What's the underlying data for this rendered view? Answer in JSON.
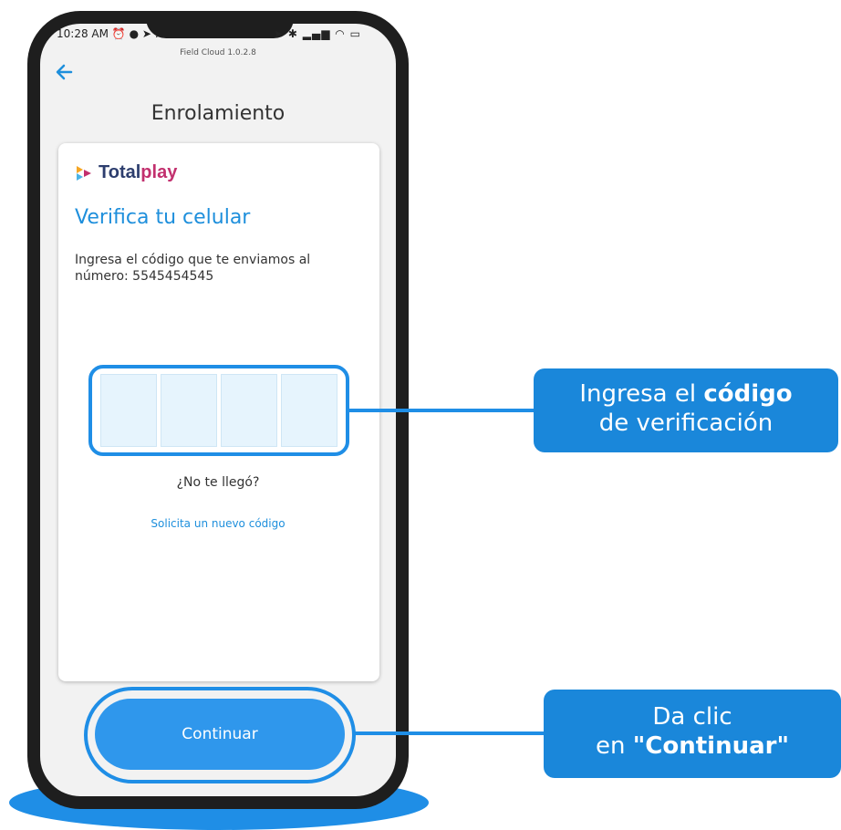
{
  "status_bar": {
    "time": "10:28 AM",
    "app_version": "Field Cloud 1.0.2.8"
  },
  "header": {
    "title": "Enrolamiento"
  },
  "card": {
    "brand_part1": "Total",
    "brand_part2": "play",
    "heading": "Verifica tu celular",
    "description": "Ingresa el código que te enviamos al número: 5545454545",
    "code_digits": [
      "",
      "",
      "",
      ""
    ],
    "not_received": "¿No te llegó?",
    "resend_link": "Solicita un nuevo código"
  },
  "actions": {
    "continue_label": "Continuar"
  },
  "callouts": {
    "code": {
      "pre": "Ingresa el ",
      "bold": "código",
      "post": "de verificación"
    },
    "continue": {
      "line1": "Da clic",
      "pre": "en ",
      "bold": "\"Continuar\""
    }
  },
  "colors": {
    "accent": "#1f8ee6",
    "brand_navy": "#2d3e6e",
    "brand_pink": "#c2306e",
    "link": "#1e8fdc"
  }
}
